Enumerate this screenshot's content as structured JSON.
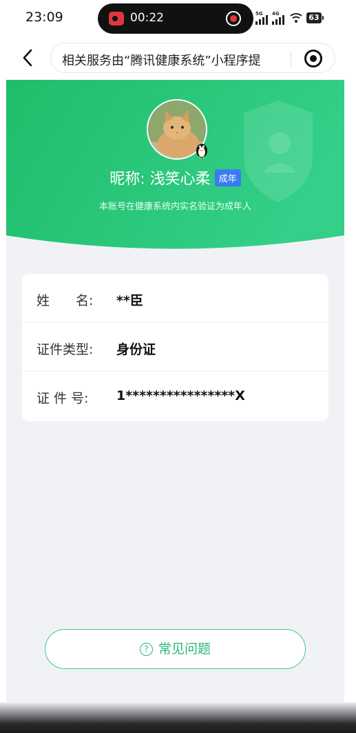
{
  "status_bar": {
    "time": "23:09",
    "recording_time": "00:22",
    "network_5g": "5G",
    "network_4g": "4G",
    "battery": "63"
  },
  "nav": {
    "url_text": "相关服务由“腾讯健康系统”小程序提",
    "icons": [
      "back-arrow-icon",
      "target-icon"
    ]
  },
  "profile": {
    "nickname": "昵称: 浅笑心柔",
    "badge": "成年",
    "note": "本账号在健康系统内实名验证为成年人"
  },
  "info": {
    "rows": [
      {
        "label": "姓　　名:",
        "value": "**臣"
      },
      {
        "label": "证件类型:",
        "value": "身份证"
      },
      {
        "label": "证 件 号:",
        "value": "1****************X"
      }
    ]
  },
  "faq": {
    "label": "常见问题",
    "icon_glyph": "?"
  },
  "colors": {
    "brand_green": "#24c274",
    "badge_blue": "#3a7cf0",
    "background": "#f1f2f6"
  }
}
